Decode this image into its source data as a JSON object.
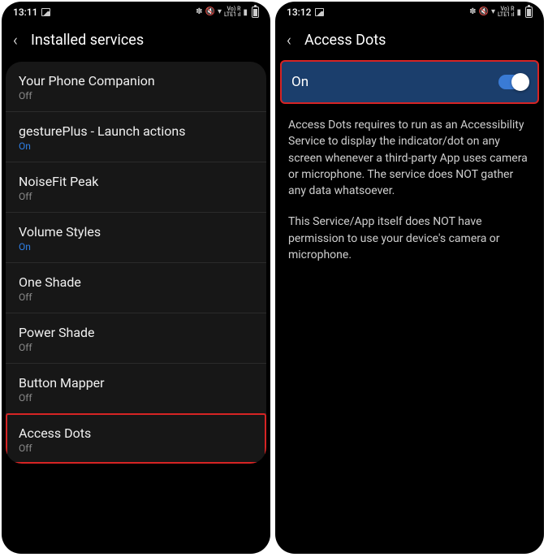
{
  "left": {
    "time": "13:11",
    "title": "Installed services",
    "services": [
      {
        "name": "Your Phone Companion",
        "status": "Off",
        "on": false
      },
      {
        "name": "gesturePlus - Launch actions",
        "status": "On",
        "on": true
      },
      {
        "name": "NoiseFit Peak",
        "status": "Off",
        "on": false
      },
      {
        "name": "Volume Styles",
        "status": "On",
        "on": true
      },
      {
        "name": "One Shade",
        "status": "Off",
        "on": false
      },
      {
        "name": "Power Shade",
        "status": "Off",
        "on": false
      },
      {
        "name": "Button Mapper",
        "status": "Off",
        "on": false
      },
      {
        "name": "Access Dots",
        "status": "Off",
        "on": false
      }
    ]
  },
  "right": {
    "time": "13:12",
    "title": "Access Dots",
    "toggle_label": "On",
    "desc1": "Access Dots requires to run as an Accessibility Service to display the indicator/dot on any screen whenever a third-party App uses camera or microphone. The service does NOT gather any data whatsoever.",
    "desc2": "This Service/App itself does NOT have permission to use your device's camera or microphone."
  },
  "status_icons": {
    "lte_label_top": "Vo) R",
    "lte_label_bot": "LTE1 ıl"
  }
}
